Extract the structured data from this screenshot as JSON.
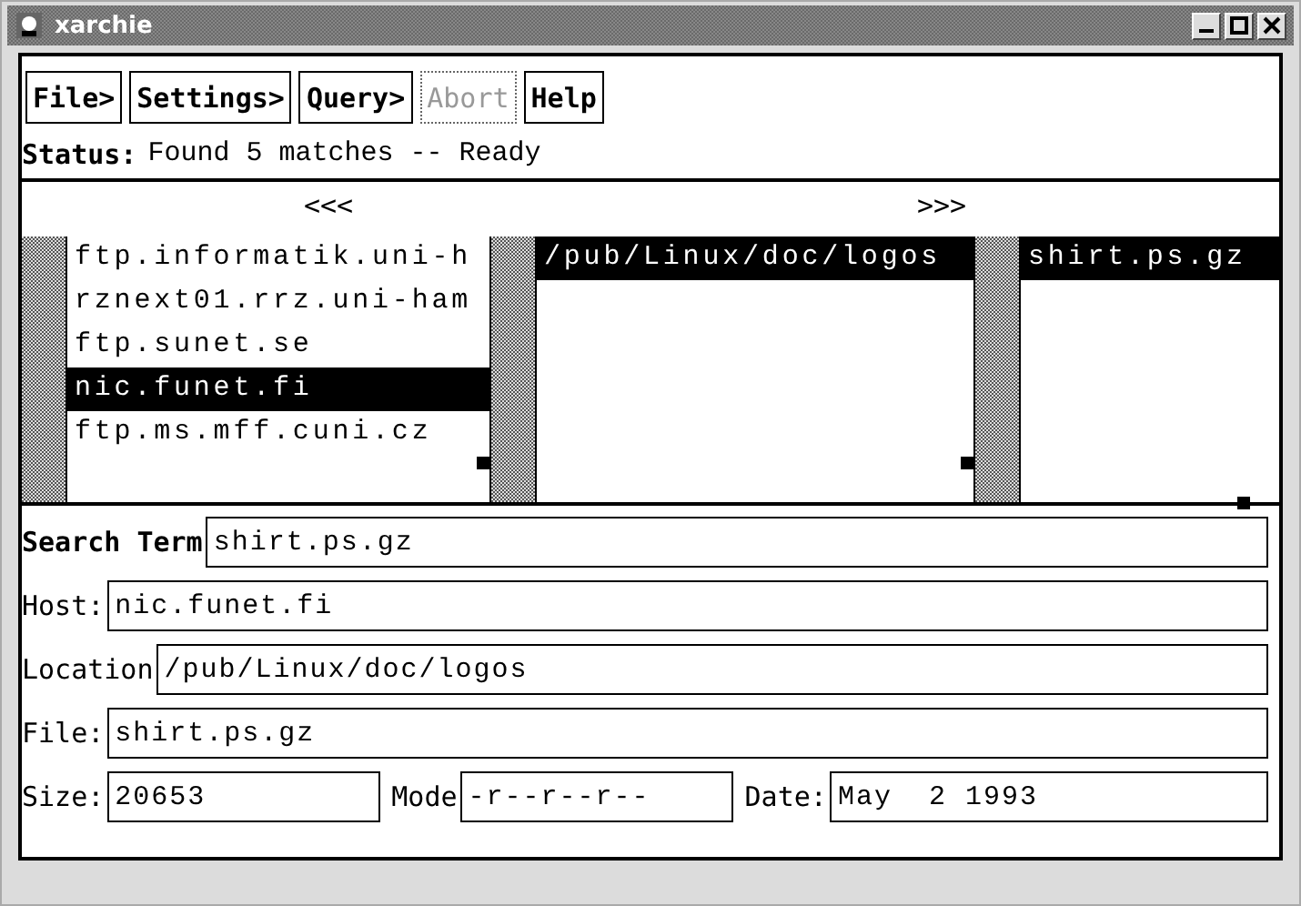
{
  "window": {
    "title": "xarchie"
  },
  "menu": [
    {
      "label": "File>",
      "disabled": false
    },
    {
      "label": "Settings>",
      "disabled": false
    },
    {
      "label": "Query>",
      "disabled": false
    },
    {
      "label": "Abort",
      "disabled": true
    },
    {
      "label": "Help",
      "disabled": false
    }
  ],
  "status": {
    "label": "Status:",
    "text": "Found 5 matches -- Ready"
  },
  "browser": {
    "scroll_left": "<<<",
    "scroll_right": ">>>",
    "columns": [
      {
        "items": [
          {
            "text": "ftp.informatik.uni-h",
            "selected": false
          },
          {
            "text": "rznext01.rrz.uni-ham",
            "selected": false
          },
          {
            "text": "ftp.sunet.se",
            "selected": false
          },
          {
            "text": "nic.funet.fi",
            "selected": true
          },
          {
            "text": "ftp.ms.mff.cuni.cz",
            "selected": false
          }
        ]
      },
      {
        "items": [
          {
            "text": "/pub/Linux/doc/logos",
            "selected": true
          }
        ]
      },
      {
        "items": [
          {
            "text": "shirt.ps.gz",
            "selected": true
          }
        ]
      }
    ]
  },
  "fields": [
    {
      "label": "Search Term",
      "value": "shirt.ps.gz",
      "bold": true
    },
    {
      "label": "Host:",
      "value": "nic.funet.fi",
      "bold": false
    },
    {
      "label": "Location",
      "value": "/pub/Linux/doc/logos",
      "bold": false
    },
    {
      "label": "File:",
      "value": "shirt.ps.gz",
      "bold": false
    }
  ],
  "details": [
    {
      "label": "Size:",
      "value": "20653"
    },
    {
      "label": "Mode",
      "value": "-r--r--r--"
    },
    {
      "label": "Date:",
      "value": "May  2 1993"
    }
  ]
}
